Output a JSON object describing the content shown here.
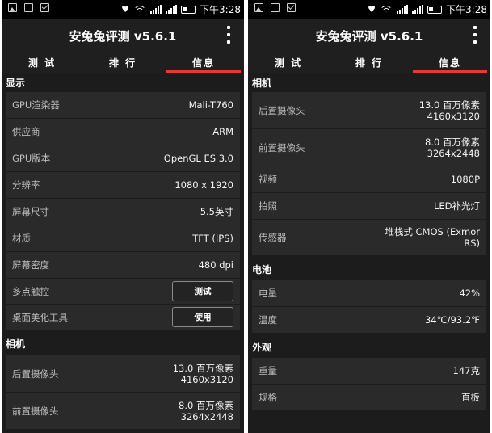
{
  "status": {
    "time": "下午3:28"
  },
  "app": {
    "title": "安兔兔评测 v5.6.1"
  },
  "tabs": [
    "测 试",
    "排 行",
    "信息"
  ],
  "left": {
    "display_header": "显示",
    "display": [
      {
        "label": "GPU渲染器",
        "value": "Mali-T760"
      },
      {
        "label": "供应商",
        "value": "ARM"
      },
      {
        "label": "GPU版本",
        "value": "OpenGL ES 3.0"
      },
      {
        "label": "分辨率",
        "value": "1080 x 1920"
      },
      {
        "label": "屏幕尺寸",
        "value": "5.5英寸"
      },
      {
        "label": "材质",
        "value": "TFT (IPS)"
      },
      {
        "label": "屏幕密度",
        "value": "480 dpi"
      },
      {
        "label": "多点触控",
        "button": "测试"
      },
      {
        "label": "桌面美化工具",
        "button": "使用"
      }
    ],
    "camera_header": "相机",
    "camera": [
      {
        "label": "后置摄像头",
        "value_line1": "13.0 百万像素",
        "value_line2": "4160x3120"
      },
      {
        "label": "前置摄像头",
        "value_line1": "8.0 百万像素",
        "value_line2": "3264x2448"
      }
    ]
  },
  "right": {
    "camera_header": "相机",
    "camera": [
      {
        "label": "后置摄像头",
        "value_line1": "13.0 百万像素",
        "value_line2": "4160x3120"
      },
      {
        "label": "前置摄像头",
        "value_line1": "8.0 百万像素",
        "value_line2": "3264x2448"
      },
      {
        "label": "视频",
        "value": "1080P"
      },
      {
        "label": "拍照",
        "value": "LED补光灯"
      },
      {
        "label": "传感器",
        "value_line1": "堆栈式 CMOS (Exmor",
        "value_line2": "RS)"
      }
    ],
    "battery_header": "电池",
    "battery": [
      {
        "label": "电量",
        "value": "42%"
      },
      {
        "label": "温度",
        "value": "34℃/93.2℉"
      }
    ],
    "appearance_header": "外观",
    "appearance": [
      {
        "label": "重量",
        "value": "147克"
      },
      {
        "label": "规格",
        "value": "直板"
      }
    ]
  },
  "colors": {
    "accent": "#e53935",
    "background": "#1c1c1c",
    "row": "#2a2a2a"
  },
  "icons": [
    "heart-signal-icon",
    "wifi-icon",
    "cellular-signal-icon",
    "battery-icon",
    "image-notification-icon",
    "mail-notification-icon",
    "overflow-menu-icon"
  ]
}
